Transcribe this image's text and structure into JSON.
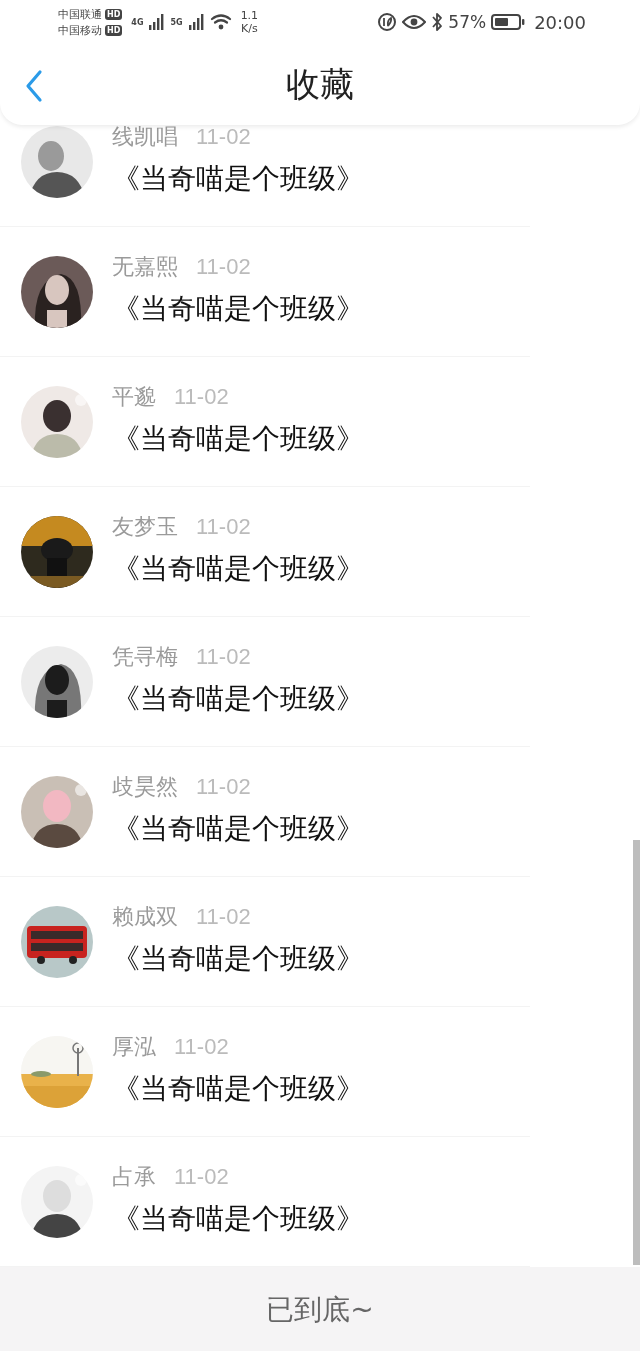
{
  "status_bar": {
    "carrier_1": "中国联通",
    "carrier_1_badge": "HD",
    "carrier_2": "中国移动",
    "carrier_2_badge": "HD",
    "network_1": "4G",
    "network_2": "5G",
    "speed_value": "1.1",
    "speed_unit": "K/s",
    "battery": "57%",
    "time": "20:00"
  },
  "header": {
    "title": "收藏"
  },
  "items": [
    {
      "name": "线凯唱",
      "date": "11-02",
      "title": "《当奇喵是个班级》"
    },
    {
      "name": "无嘉熙",
      "date": "11-02",
      "title": "《当奇喵是个班级》"
    },
    {
      "name": "平邈",
      "date": "11-02",
      "title": "《当奇喵是个班级》"
    },
    {
      "name": "友梦玉",
      "date": "11-02",
      "title": "《当奇喵是个班级》"
    },
    {
      "name": "凭寻梅",
      "date": "11-02",
      "title": "《当奇喵是个班级》"
    },
    {
      "name": "歧昊然",
      "date": "11-02",
      "title": "《当奇喵是个班级》"
    },
    {
      "name": "赖成双",
      "date": "11-02",
      "title": "《当奇喵是个班级》"
    },
    {
      "name": "厚泓",
      "date": "11-02",
      "title": "《当奇喵是个班级》"
    },
    {
      "name": "占承",
      "date": "11-02",
      "title": "《当奇喵是个班级》"
    }
  ],
  "footer": {
    "text": "已到底~"
  }
}
